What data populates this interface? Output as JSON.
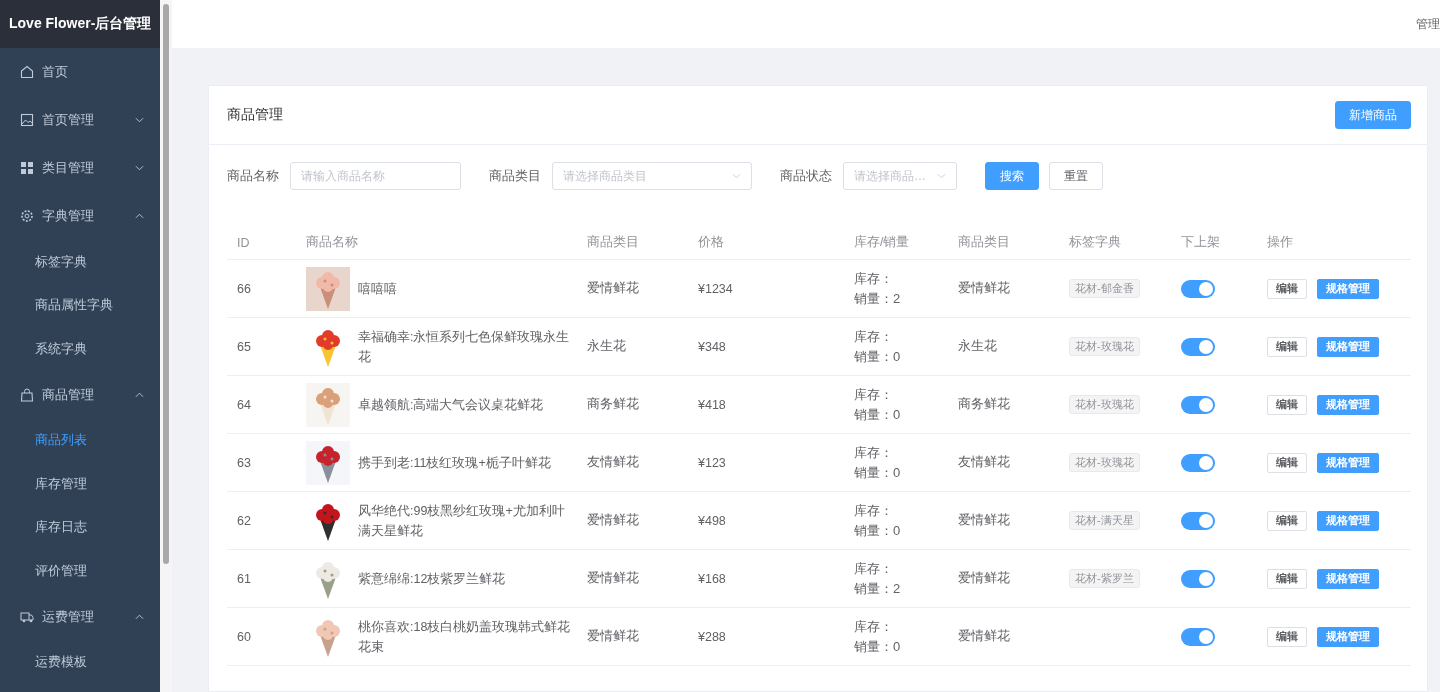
{
  "sidebar": {
    "brand": "Love Flower-后台管理",
    "items": [
      {
        "label": "首页"
      },
      {
        "label": "首页管理",
        "expanded": false
      },
      {
        "label": "类目管理",
        "expanded": false
      },
      {
        "label": "字典管理",
        "expanded": true,
        "children": [
          {
            "label": "标签字典",
            "selected": false
          },
          {
            "label": "商品属性字典",
            "selected": false
          },
          {
            "label": "系统字典",
            "selected": false
          }
        ]
      },
      {
        "label": "商品管理",
        "expanded": true,
        "children": [
          {
            "label": "商品列表",
            "selected": true
          },
          {
            "label": "库存管理",
            "selected": false
          },
          {
            "label": "库存日志",
            "selected": false
          },
          {
            "label": "评价管理",
            "selected": false
          }
        ]
      },
      {
        "label": "运费管理",
        "expanded": true,
        "children": [
          {
            "label": "运费模板",
            "selected": false
          }
        ]
      }
    ]
  },
  "header": {
    "user": "管理"
  },
  "card": {
    "title": "商品管理",
    "add_button": "新增商品"
  },
  "filters": [
    {
      "kind": "input",
      "label": "商品名称",
      "placeholder": "请输入商品名称"
    },
    {
      "kind": "select",
      "label": "商品类目",
      "placeholder": "请选择商品类目"
    },
    {
      "kind": "select",
      "label": "商品状态",
      "placeholder": "请选择商品…"
    }
  ],
  "filter_buttons": [
    "搜索",
    "重置"
  ],
  "table": {
    "columns": [
      "ID",
      "商品名称",
      "商品类目",
      "价格",
      "库存/销量",
      "商品类目",
      "标签字典",
      "下上架",
      "操作"
    ],
    "rows": [
      {
        "id": "66",
        "image": {
          "kind": "picture"
        },
        "name": "嘻嘻嘻",
        "category": "爱情鲜花",
        "price": "¥1234",
        "stock": "库存：",
        "sales": "销量：2",
        "category_2": "爱情鲜花",
        "tag": "花材-郁金香",
        "on": true,
        "actions": [
          "编辑",
          "规格管理"
        ]
      },
      {
        "id": "65",
        "image": {
          "kind": "picture"
        },
        "name": "幸福确幸:永恒系列七色保鲜玫瑰永生花",
        "category": "永生花",
        "price": "¥348",
        "stock": "库存：",
        "sales": "销量：0",
        "category_2": "永生花",
        "tag": "花材-玫瑰花",
        "on": true,
        "actions": [
          "编辑",
          "规格管理"
        ]
      },
      {
        "id": "64",
        "image": {
          "kind": "picture"
        },
        "name": "卓越领航:高端大气会议桌花鲜花",
        "category": "商务鲜花",
        "price": "¥418",
        "stock": "库存：",
        "sales": "销量：0",
        "category_2": "商务鲜花",
        "tag": "花材-玫瑰花",
        "on": true,
        "actions": [
          "编辑",
          "规格管理"
        ]
      },
      {
        "id": "63",
        "image": {
          "kind": "picture"
        },
        "name": "携手到老:11枝红玫瑰+栀子叶鲜花",
        "category": "友情鲜花",
        "price": "¥123",
        "stock": "库存：",
        "sales": "销量：0",
        "category_2": "友情鲜花",
        "tag": "花材-玫瑰花",
        "on": true,
        "actions": [
          "编辑",
          "规格管理"
        ]
      },
      {
        "id": "62",
        "image": {
          "kind": "picture"
        },
        "name": "风华绝代:99枝黑纱红玫瑰+尤加利叶满天星鲜花",
        "category": "爱情鲜花",
        "price": "¥498",
        "stock": "库存：",
        "sales": "销量：0",
        "category_2": "爱情鲜花",
        "tag": "花材-满天星",
        "on": true,
        "actions": [
          "编辑",
          "规格管理"
        ]
      },
      {
        "id": "61",
        "image": {
          "kind": "picture"
        },
        "name": "紫意绵绵:12枝紫罗兰鲜花",
        "category": "爱情鲜花",
        "price": "¥168",
        "stock": "库存：",
        "sales": "销量：2",
        "category_2": "爱情鲜花",
        "tag": "花材-紫罗兰",
        "on": true,
        "actions": [
          "编辑",
          "规格管理"
        ]
      },
      {
        "id": "60",
        "image": {
          "kind": "picture"
        },
        "name": "桃你喜欢:18枝白桃奶盖玫瑰韩式鲜花花束",
        "category": "爱情鲜花",
        "price": "¥288",
        "stock": "库存：",
        "sales": "销量：0",
        "category_2": "爱情鲜花",
        "on": true,
        "actions": [
          "编辑",
          "规格管理"
        ]
      }
    ]
  }
}
